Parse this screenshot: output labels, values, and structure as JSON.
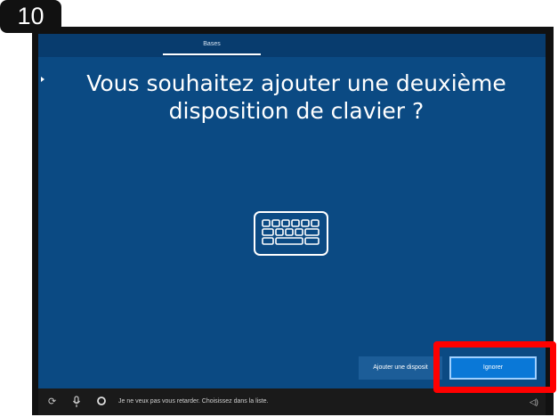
{
  "step_badge": "10",
  "tab": {
    "label": "Bases"
  },
  "title": "Vous souhaitez ajouter une deuxième disposition de clavier ?",
  "buttons": {
    "secondary_label": "Ajouter une disposit",
    "primary_label": "Ignorer"
  },
  "taskbar": {
    "hint": "Je ne veux pas vous retarder. Choisissez dans la liste."
  },
  "icons": [
    "keyboard-icon",
    "accessibility-icon",
    "microphone-icon",
    "cortana-icon",
    "volume-icon"
  ],
  "colors": {
    "screen": "#0b4a83",
    "primary_button": "#0a78d7",
    "highlight": "#ff0000"
  }
}
